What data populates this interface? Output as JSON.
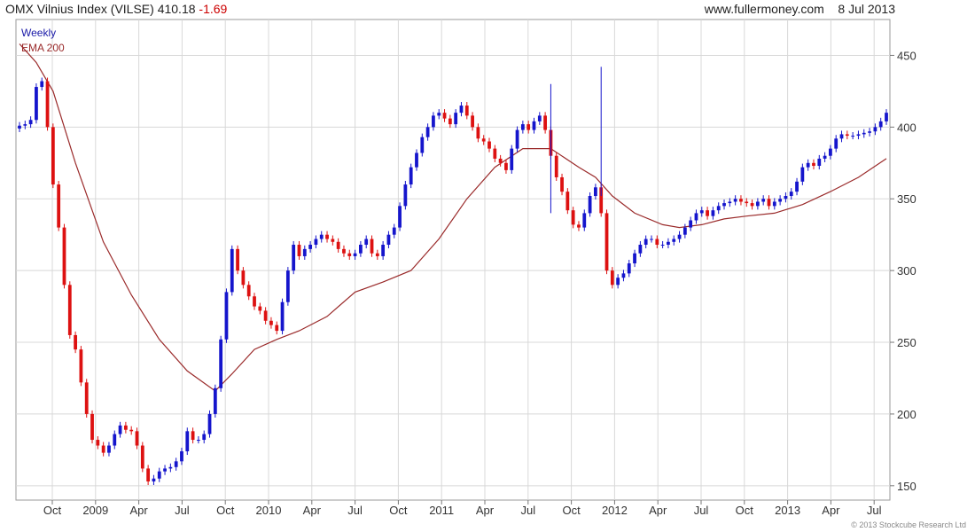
{
  "header": {
    "index_name": "OMX Vilnius Index (VILSE)",
    "last": "410.18",
    "change": "-1.69",
    "site": "www.fullermoney.com",
    "date": "8 Jul 2013"
  },
  "chart_data": {
    "type": "candlestick",
    "period_label": "Weekly",
    "ylim": [
      140,
      475
    ],
    "yticks": [
      150,
      200,
      250,
      300,
      350,
      400,
      450
    ],
    "xtick_labels": [
      "Oct",
      "2009",
      "Apr",
      "Jul",
      "Oct",
      "2010",
      "Apr",
      "Jul",
      "Oct",
      "2011",
      "Apr",
      "Jul",
      "Oct",
      "2012",
      "Apr",
      "Jul",
      "Oct",
      "2013",
      "Apr",
      "Jul"
    ],
    "grid": true,
    "legend_placement": "top-left",
    "colors": {
      "up": "#1515cc",
      "down": "#dd1111",
      "ema": "#9a2a2a",
      "grid": "#d8d8d8"
    },
    "close_points": [
      [
        0,
        401
      ],
      [
        1,
        402
      ],
      [
        2,
        405
      ],
      [
        3,
        428
      ],
      [
        4,
        432
      ],
      [
        5,
        400
      ],
      [
        6,
        360
      ],
      [
        7,
        330
      ],
      [
        8,
        290
      ],
      [
        9,
        255
      ],
      [
        10,
        245
      ],
      [
        11,
        222
      ],
      [
        12,
        200
      ],
      [
        13,
        182
      ],
      [
        14,
        178
      ],
      [
        15,
        173
      ],
      [
        16,
        178
      ],
      [
        17,
        186
      ],
      [
        18,
        192
      ],
      [
        19,
        189
      ],
      [
        20,
        188
      ],
      [
        21,
        178
      ],
      [
        22,
        162
      ],
      [
        23,
        153
      ],
      [
        24,
        155
      ],
      [
        25,
        160
      ],
      [
        26,
        162
      ],
      [
        27,
        163
      ],
      [
        28,
        167
      ],
      [
        29,
        174
      ],
      [
        30,
        188
      ],
      [
        31,
        182
      ],
      [
        32,
        182
      ],
      [
        33,
        186
      ],
      [
        34,
        200
      ],
      [
        35,
        218
      ],
      [
        36,
        252
      ],
      [
        37,
        285
      ],
      [
        38,
        315
      ],
      [
        39,
        300
      ],
      [
        40,
        290
      ],
      [
        41,
        282
      ],
      [
        42,
        275
      ],
      [
        43,
        272
      ],
      [
        44,
        265
      ],
      [
        45,
        262
      ],
      [
        46,
        258
      ],
      [
        47,
        278
      ],
      [
        48,
        300
      ],
      [
        49,
        318
      ],
      [
        50,
        310
      ],
      [
        51,
        315
      ],
      [
        52,
        318
      ],
      [
        53,
        322
      ],
      [
        54,
        325
      ],
      [
        55,
        322
      ],
      [
        56,
        320
      ],
      [
        57,
        315
      ],
      [
        58,
        312
      ],
      [
        59,
        310
      ],
      [
        60,
        312
      ],
      [
        61,
        318
      ],
      [
        62,
        322
      ],
      [
        63,
        312
      ],
      [
        64,
        310
      ],
      [
        65,
        318
      ],
      [
        66,
        325
      ],
      [
        67,
        330
      ],
      [
        68,
        345
      ],
      [
        69,
        360
      ],
      [
        70,
        372
      ],
      [
        71,
        382
      ],
      [
        72,
        393
      ],
      [
        73,
        400
      ],
      [
        74,
        408
      ],
      [
        75,
        410
      ],
      [
        76,
        406
      ],
      [
        77,
        402
      ],
      [
        78,
        410
      ],
      [
        79,
        415
      ],
      [
        80,
        408
      ],
      [
        81,
        400
      ],
      [
        82,
        392
      ],
      [
        83,
        390
      ],
      [
        84,
        385
      ],
      [
        85,
        378
      ],
      [
        86,
        375
      ],
      [
        87,
        370
      ],
      [
        88,
        385
      ],
      [
        89,
        398
      ],
      [
        90,
        402
      ],
      [
        91,
        398
      ],
      [
        92,
        404
      ],
      [
        93,
        408
      ],
      [
        94,
        398
      ],
      [
        95,
        380
      ],
      [
        96,
        365
      ],
      [
        97,
        355
      ],
      [
        98,
        342
      ],
      [
        99,
        332
      ],
      [
        100,
        330
      ],
      [
        101,
        340
      ],
      [
        102,
        352
      ],
      [
        103,
        358
      ],
      [
        104,
        340
      ],
      [
        105,
        300
      ],
      [
        106,
        290
      ],
      [
        107,
        295
      ],
      [
        108,
        298
      ],
      [
        109,
        305
      ],
      [
        110,
        312
      ],
      [
        111,
        318
      ],
      [
        112,
        322
      ],
      [
        113,
        322
      ],
      [
        114,
        318
      ],
      [
        115,
        318
      ],
      [
        116,
        320
      ],
      [
        117,
        322
      ],
      [
        118,
        325
      ],
      [
        119,
        330
      ],
      [
        120,
        335
      ],
      [
        121,
        340
      ],
      [
        122,
        342
      ],
      [
        123,
        338
      ],
      [
        124,
        342
      ],
      [
        125,
        345
      ],
      [
        126,
        347
      ],
      [
        127,
        348
      ],
      [
        128,
        350
      ],
      [
        129,
        348
      ],
      [
        130,
        347
      ],
      [
        131,
        345
      ],
      [
        132,
        348
      ],
      [
        133,
        350
      ],
      [
        134,
        345
      ],
      [
        135,
        348
      ],
      [
        136,
        350
      ],
      [
        137,
        352
      ],
      [
        138,
        355
      ],
      [
        139,
        362
      ],
      [
        140,
        372
      ],
      [
        141,
        375
      ],
      [
        142,
        373
      ],
      [
        143,
        378
      ],
      [
        144,
        380
      ],
      [
        145,
        385
      ],
      [
        146,
        392
      ],
      [
        147,
        395
      ],
      [
        148,
        394
      ],
      [
        149,
        394
      ],
      [
        150,
        395
      ],
      [
        151,
        396
      ],
      [
        152,
        397
      ],
      [
        153,
        400
      ],
      [
        154,
        404
      ],
      [
        155,
        410
      ]
    ],
    "ema_points": [
      [
        0,
        458
      ],
      [
        3,
        445
      ],
      [
        6,
        425
      ],
      [
        10,
        375
      ],
      [
        15,
        320
      ],
      [
        20,
        283
      ],
      [
        25,
        252
      ],
      [
        30,
        230
      ],
      [
        35,
        216
      ],
      [
        38,
        228
      ],
      [
        42,
        245
      ],
      [
        46,
        252
      ],
      [
        50,
        258
      ],
      [
        55,
        268
      ],
      [
        60,
        285
      ],
      [
        65,
        292
      ],
      [
        70,
        300
      ],
      [
        75,
        322
      ],
      [
        80,
        350
      ],
      [
        85,
        372
      ],
      [
        90,
        385
      ],
      [
        95,
        385
      ],
      [
        100,
        372
      ],
      [
        103,
        365
      ],
      [
        106,
        352
      ],
      [
        110,
        340
      ],
      [
        115,
        332
      ],
      [
        118,
        330
      ],
      [
        122,
        332
      ],
      [
        126,
        336
      ],
      [
        130,
        338
      ],
      [
        135,
        340
      ],
      [
        140,
        346
      ],
      [
        145,
        355
      ],
      [
        150,
        365
      ],
      [
        155,
        378
      ]
    ],
    "marker_points": [
      [
        95,
        360
      ],
      [
        104,
        372
      ]
    ]
  },
  "legend": {
    "weekly": "Weekly",
    "ema": "EMA 200"
  },
  "copyright": "© 2013 Stockcube Research Ltd"
}
